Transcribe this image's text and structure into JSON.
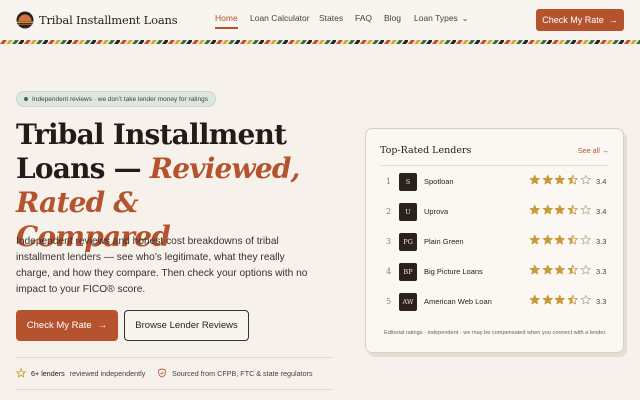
{
  "brand": {
    "name": "Tribal Installment Loans"
  },
  "nav": {
    "items": [
      {
        "label": "Home",
        "active": true
      },
      {
        "label": "Loan Calculator",
        "active": false
      },
      {
        "label": "States",
        "active": false
      },
      {
        "label": "FAQ",
        "active": false
      },
      {
        "label": "Blog",
        "active": false
      },
      {
        "label": "Loan Types",
        "active": false,
        "dropdown": true
      }
    ],
    "cta": "Check My Rate"
  },
  "hero": {
    "badge": "Independent reviews · we don’t take lender money for ratings",
    "title_line1": "Tribal Installment",
    "title_line2_plain": "Loans — ",
    "title_line2_accent": "Reviewed, Rated &",
    "title_line3_accent": "Compared",
    "lede": "Independent reviews and honest cost breakdowns of tribal installment lenders — see who’s legitimate, what they really charge, and how they compare. Then check your options with no impact to your FICO® score.",
    "primary_cta": "Check My Rate",
    "secondary_cta": "Browse Lender Reviews",
    "trust": [
      {
        "strong": "6+ lenders",
        "text": "reviewed independently",
        "icon": "star-outline-icon"
      },
      {
        "strong": "",
        "text": "Sourced from CFPB, FTC & state regulators",
        "icon": "shield-check-icon"
      }
    ]
  },
  "top_rated": {
    "title": "Top-Rated Lenders",
    "see_all": "See all",
    "lenders": [
      {
        "rank": "1",
        "initials": "S",
        "name": "Spotloan",
        "rating": 3.4,
        "score": "3.4"
      },
      {
        "rank": "2",
        "initials": "U",
        "name": "Uprova",
        "rating": 3.4,
        "score": "3.4"
      },
      {
        "rank": "3",
        "initials": "PG",
        "name": "Plain Green",
        "rating": 3.3,
        "score": "3.3"
      },
      {
        "rank": "4",
        "initials": "BP",
        "name": "Big Picture Loans",
        "rating": 3.3,
        "score": "3.3"
      },
      {
        "rank": "5",
        "initials": "AW",
        "name": "American Web Loan",
        "rating": 3.3,
        "score": "3.3"
      }
    ],
    "disclaimer": "Editorial ratings · independent · we may be compensated when you connect with a lender."
  },
  "colors": {
    "accent": "#b4532e",
    "ink": "#231b16",
    "background": "#f6f1ea",
    "star": "#c99a3a",
    "badge_bg": "#dde6df"
  }
}
